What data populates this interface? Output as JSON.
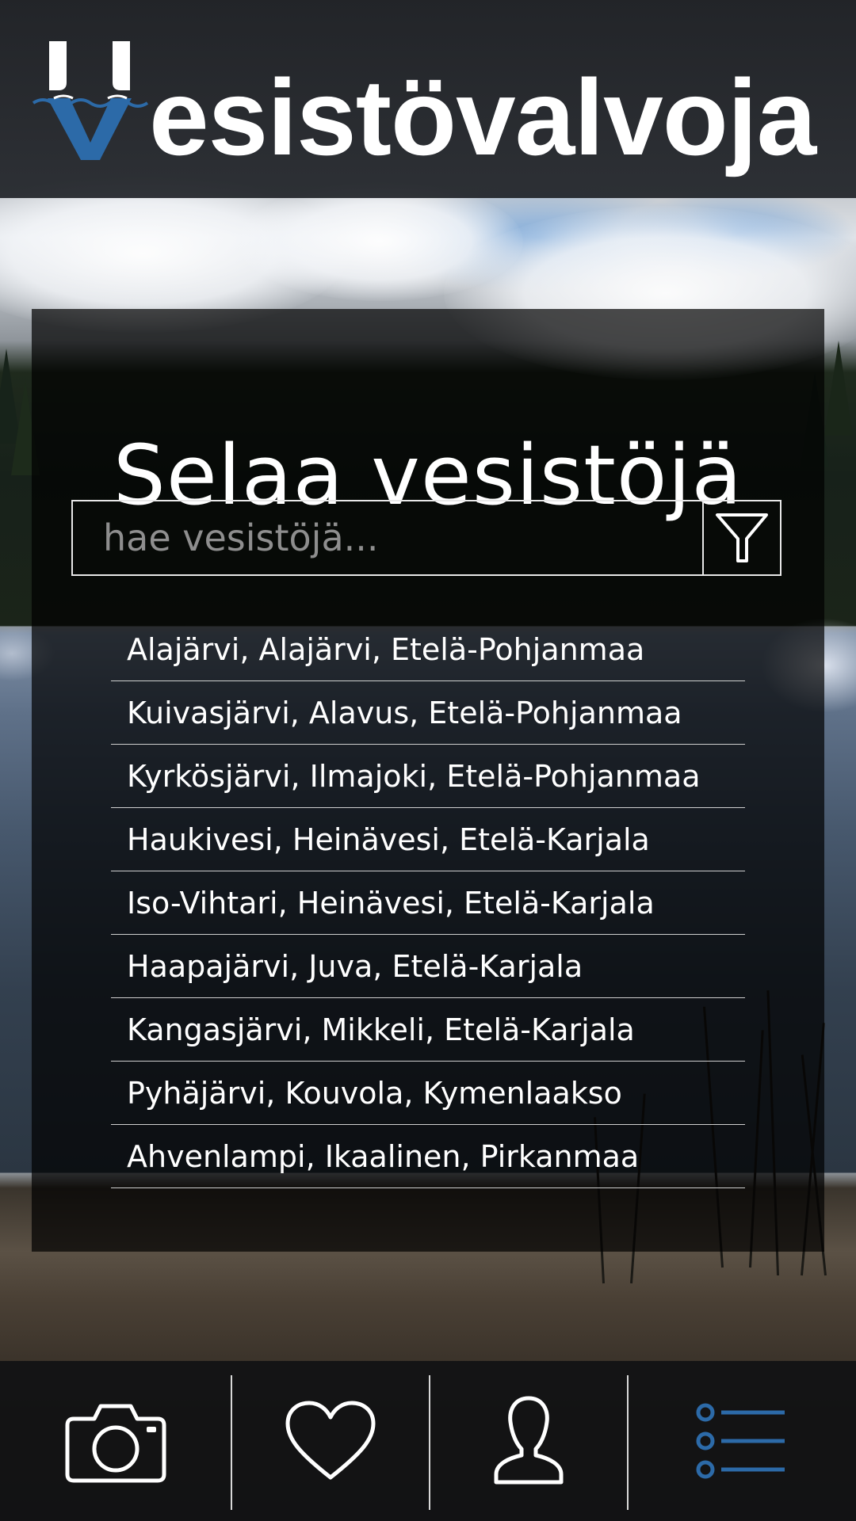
{
  "app": {
    "name": "esistövalvoja",
    "logo_letter": "V",
    "brand_color": "#2c6aa8"
  },
  "main": {
    "title": "Selaa vesistöjä",
    "search": {
      "placeholder": "hae vesistöjä...",
      "value": ""
    },
    "filter_icon": "filter-icon",
    "results": [
      "Alajärvi, Alajärvi, Etelä-Pohjanmaa",
      "Kuivasjärvi, Alavus, Etelä-Pohjanmaa",
      "Kyrkösjärvi, Ilmajoki, Etelä-Pohjanmaa",
      "Haukivesi, Heinävesi, Etelä-Karjala",
      "Iso-Vihtari, Heinävesi, Etelä-Karjala",
      "Haapajärvi, Juva, Etelä-Karjala",
      "Kangasjärvi, Mikkeli, Etelä-Karjala",
      "Pyhäjärvi, Kouvola, Kymenlaakso",
      "Ahvenlampi, Ikaalinen, Pirkanmaa"
    ]
  },
  "bottom_nav": {
    "items": [
      {
        "icon": "camera-icon",
        "active": false
      },
      {
        "icon": "heart-icon",
        "active": false
      },
      {
        "icon": "user-icon",
        "active": false
      },
      {
        "icon": "list-icon",
        "active": true
      }
    ],
    "active_color": "#2c6aa8",
    "inactive_color": "#ffffff"
  }
}
